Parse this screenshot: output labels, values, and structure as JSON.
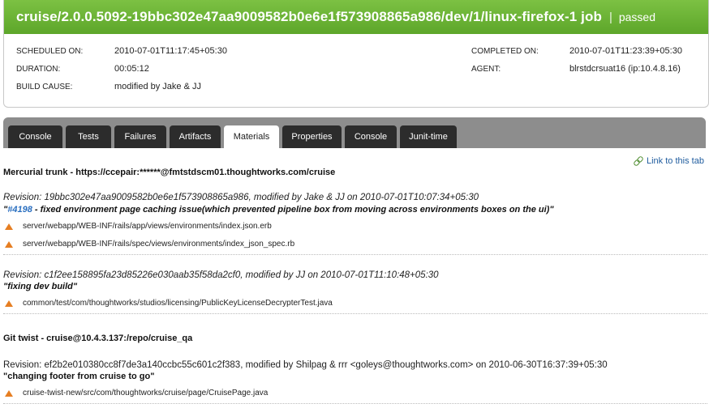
{
  "job": {
    "title": "cruise/2.0.0.5092-19bbc302e47aa9009582b0e6e1f573908865a986/dev/1/linux-firefox-1 job",
    "separator": "|",
    "status": "passed",
    "scheduled_label": "SCHEDULED ON:",
    "scheduled_value": "2010-07-01T11:17:45+05:30",
    "duration_label": "DURATION:",
    "duration_value": "00:05:12",
    "cause_label": "BUILD CAUSE:",
    "cause_value": "modified by Jake & JJ",
    "completed_label": "COMPLETED ON:",
    "completed_value": "2010-07-01T11:23:39+05:30",
    "agent_label": "AGENT:",
    "agent_value": "blrstdcrsuat16 (ip:10.4.8.16)"
  },
  "tabs": [
    {
      "label": "Console"
    },
    {
      "label": "Tests"
    },
    {
      "label": "Failures"
    },
    {
      "label": "Artifacts"
    },
    {
      "label": "Materials"
    },
    {
      "label": "Properties"
    },
    {
      "label": "Console"
    },
    {
      "label": "Junit-time"
    }
  ],
  "active_tab": "Materials",
  "link_to_tab": "Link to this tab",
  "materials": [
    {
      "title": "Mercurial trunk - https://ccepair:******@fmtstdscm01.thoughtworks.com/cruise",
      "revisions": [
        {
          "revision": "Revision: 19bbc302e47aa9009582b0e6e1f573908865a986, modified by Jake & JJ on 2010-07-01T10:07:34+05:30",
          "comment_open": "\"",
          "story": "#4198",
          "comment": " - fixed environment page caching issue(which prevented pipeline box from moving across environments boxes on the ui)\"",
          "files": [
            "server/webapp/WEB-INF/rails/app/views/environments/index.json.erb",
            "server/webapp/WEB-INF/rails/spec/views/environments/index_json_spec.rb"
          ]
        },
        {
          "revision": "Revision: c1f2ee158895fa23d85226e030aab35f58da2cf0, modified by JJ on 2010-07-01T11:10:48+05:30",
          "comment": "\"fixing dev build\"",
          "files": [
            "common/test/com/thoughtworks/studios/licensing/PublicKeyLicenseDecrypterTest.java"
          ]
        }
      ]
    },
    {
      "title": "Git twist - cruise@10.4.3.137:/repo/cruise_qa",
      "revisions": [
        {
          "revision": "Revision: ef2b2e010380cc8f7de3a140ccbc55c601c2f383, modified by Shilpag & rrr <goleys@thoughtworks.com> on 2010-06-30T16:37:39+05:30",
          "comment": "\"changing footer from cruise to go\"",
          "files": [
            "cruise-twist-new/src/com/thoughtworks/cruise/page/CruisePage.java"
          ]
        }
      ]
    }
  ],
  "colors": {
    "header_green": "#6bb536",
    "tab_dark": "#2c2c2c",
    "tabbar_gray": "#8d8d8d",
    "link_blue": "#1f5c9e",
    "file_icon_orange": "#e67e22"
  }
}
